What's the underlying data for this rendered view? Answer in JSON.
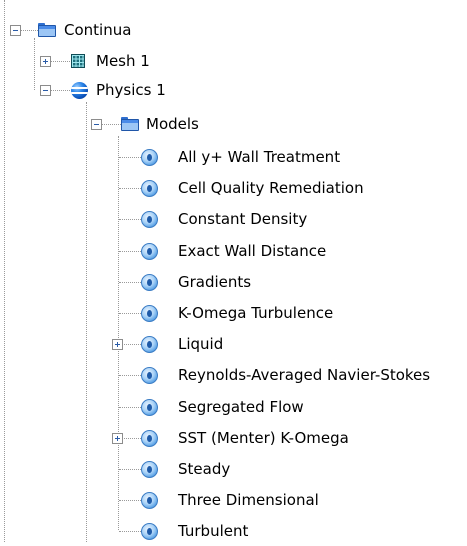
{
  "tree": {
    "continua": {
      "label": "Continua",
      "icon": "folder-icon",
      "expanded": true
    },
    "mesh": {
      "label": "Mesh 1",
      "icon": "mesh-icon",
      "expanded": false
    },
    "physics": {
      "label": "Physics 1",
      "icon": "sphere-icon",
      "expanded": true
    },
    "models": {
      "label": "Models",
      "icon": "folder-icon",
      "expanded": true
    },
    "model_items": [
      {
        "label": "All y+ Wall Treatment",
        "expandable": false
      },
      {
        "label": "Cell Quality Remediation",
        "expandable": false
      },
      {
        "label": "Constant Density",
        "expandable": false
      },
      {
        "label": "Exact Wall Distance",
        "expandable": false
      },
      {
        "label": "Gradients",
        "expandable": false
      },
      {
        "label": "K-Omega Turbulence",
        "expandable": false
      },
      {
        "label": "Liquid",
        "expandable": true
      },
      {
        "label": "Reynolds-Averaged Navier-Stokes",
        "expandable": false
      },
      {
        "label": "Segregated Flow",
        "expandable": false
      },
      {
        "label": "SST (Menter) K-Omega",
        "expandable": true
      },
      {
        "label": "Steady",
        "expandable": false
      },
      {
        "label": "Three Dimensional",
        "expandable": false
      },
      {
        "label": "Turbulent",
        "expandable": false
      }
    ]
  },
  "colors": {
    "folder": "#4a8be8",
    "mesh": "#1d6f7c",
    "physics": "#2d86e8",
    "model": "#5aa2e6",
    "connector": "#9a9a9a"
  }
}
